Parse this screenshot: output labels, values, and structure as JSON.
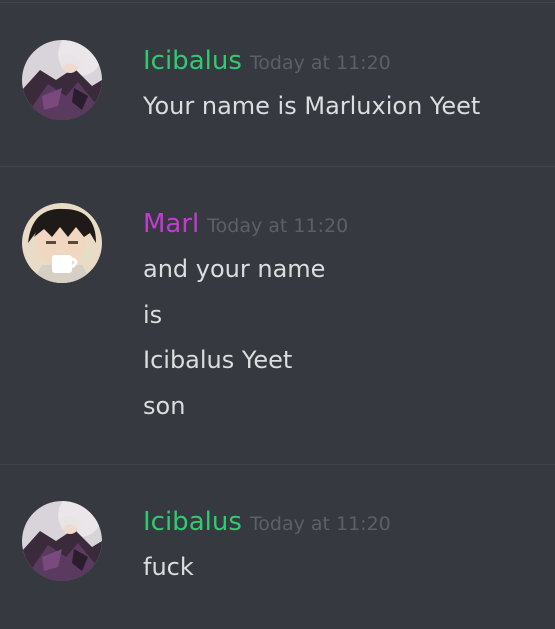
{
  "colors": {
    "background": "#36393f",
    "divider": "#42454a",
    "message_text": "#dcddde",
    "timestamp": "#5c6067"
  },
  "messages": [
    {
      "author": "Icibalus",
      "author_color": "#2ecc71",
      "timestamp": "Today at 11:20",
      "avatar": "icibalus-avatar",
      "lines": [
        "Your name is Marluxion Yeet"
      ]
    },
    {
      "author": "Marl",
      "author_color": "#c33bd1",
      "timestamp": "Today at 11:20",
      "avatar": "marl-avatar",
      "lines": [
        "and your name",
        "is",
        "Icibalus Yeet",
        "son"
      ]
    },
    {
      "author": "Icibalus",
      "author_color": "#2ecc71",
      "timestamp": "Today at 11:20",
      "avatar": "icibalus-avatar",
      "lines": [
        "fuck"
      ]
    }
  ]
}
